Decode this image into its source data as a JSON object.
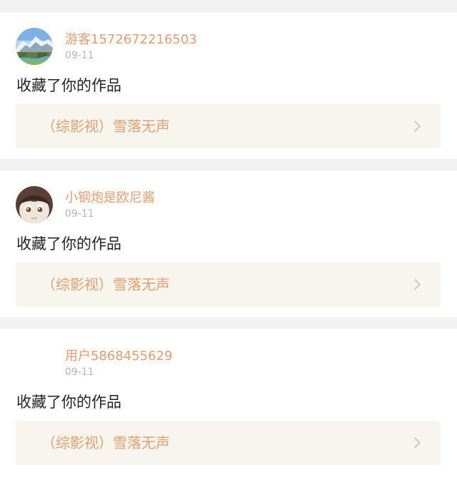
{
  "feed": {
    "items": [
      {
        "username": "游客1572672216503",
        "date": "09-11",
        "action": "收藏了你的作品",
        "work_title": "（综影视）雪落无声",
        "avatar_icon": "mountain-landscape-avatar"
      },
      {
        "username": "小钢炮是欧尼酱",
        "date": "09-11",
        "action": "收藏了你的作品",
        "work_title": "（综影视）雪落无声",
        "avatar_icon": "doll-face-avatar"
      },
      {
        "username": "用户5868455629",
        "date": "09-11",
        "action": "收藏了你的作品",
        "work_title": "（综影视）雪落无声",
        "avatar_icon": "blank-avatar"
      }
    ]
  },
  "colors": {
    "username": "#e29d72",
    "date": "#b8b8b8",
    "action": "#222222",
    "work_title": "#e0a070",
    "work_link_bg": "#f7f5ee",
    "separator": "#f2f2f2",
    "chevron": "#c8c8c8"
  }
}
